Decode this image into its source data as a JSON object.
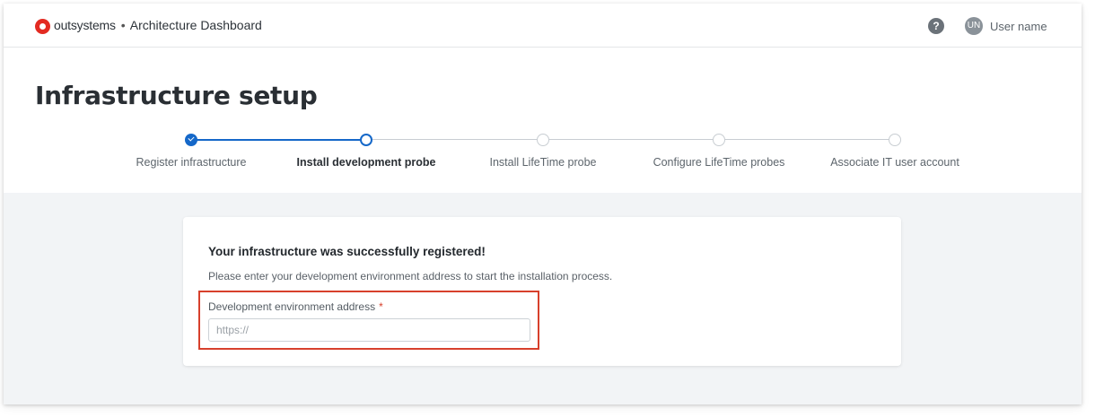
{
  "header": {
    "brand_name": "outsystems",
    "separator": "•",
    "product_name": "Architecture Dashboard",
    "help_icon": "question-circle-icon",
    "avatar_initials": "UN",
    "user_name": "User name"
  },
  "page": {
    "title": "Infrastructure setup"
  },
  "stepper": {
    "colors": {
      "done": "#1568c9",
      "future": "#c8cdd2"
    },
    "current_step": 2,
    "steps": [
      {
        "label": "Register infrastructure",
        "status": "done"
      },
      {
        "label": "Install development probe",
        "status": "current"
      },
      {
        "label": "Install LifeTime probe",
        "status": "pending"
      },
      {
        "label": "Configure LifeTime probes",
        "status": "pending"
      },
      {
        "label": "Associate IT user account",
        "status": "pending"
      }
    ]
  },
  "card": {
    "heading": "Your infrastructure was successfully registered!",
    "description": "Please enter your development environment address to start the installation process.",
    "field": {
      "label": "Development environment address",
      "required_marker": "*",
      "value": "",
      "placeholder": "https://"
    },
    "highlight_color": "#d7402c"
  }
}
